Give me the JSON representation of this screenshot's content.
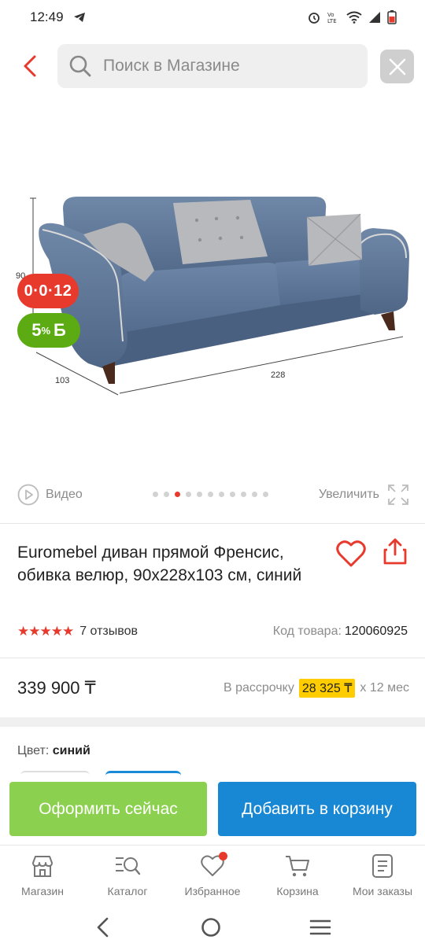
{
  "status_bar": {
    "time": "12:49"
  },
  "search": {
    "placeholder": "Поиск в Магазине"
  },
  "product": {
    "badge_installment": "0·0·12",
    "badge_bonus_percent": "5",
    "badge_bonus_suffix": "%",
    "badge_bonus_symbol": "Б",
    "image_dimensions": {
      "height": "90",
      "depth": "103",
      "width": "228"
    },
    "video_label": "Видео",
    "zoom_label": "Увеличить",
    "gallery_total": 11,
    "gallery_active_index": 2,
    "title": "Euromebel диван прямой Френсис, обивка велюр, 90x228x103 см, синий",
    "rating_stars": 5,
    "stars_text": "★★★★★",
    "reviews": "7 отзывов",
    "sku_label": "Код товара:",
    "sku_value": "120060925",
    "price": "339 900 ₸",
    "installment_label": "В рассрочку",
    "installment_amount": "28 325 ₸",
    "installment_term": "x 12 мес",
    "color_label": "Цвет:",
    "color_value": "синий"
  },
  "actions": {
    "buy_now": "Оформить сейчас",
    "add_to_cart": "Добавить в корзину"
  },
  "tabs": [
    {
      "label": "Магазин",
      "icon": "shop-icon"
    },
    {
      "label": "Каталог",
      "icon": "catalog-search-icon"
    },
    {
      "label": "Избранное",
      "icon": "heart-icon"
    },
    {
      "label": "Корзина",
      "icon": "cart-icon"
    },
    {
      "label": "Мои заказы",
      "icon": "orders-icon"
    }
  ],
  "colors": {
    "accent_red": "#e8392d",
    "green": "#8bd04e",
    "blue": "#1887d4",
    "highlight": "#ffcc00"
  }
}
